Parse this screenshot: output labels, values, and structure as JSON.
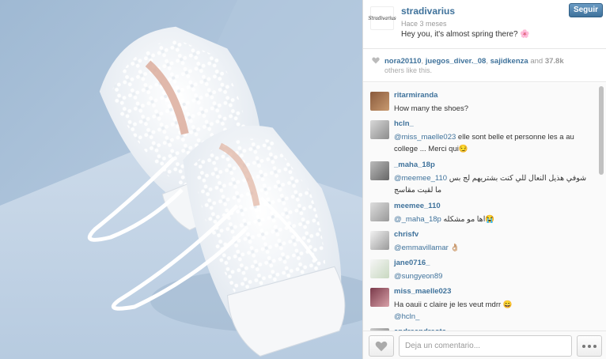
{
  "post": {
    "username": "stradivarius",
    "avatar_text": "Stradivarius",
    "time": "Hace 3 meses",
    "caption": "Hey you, it's almost spring there? 🌸",
    "follow_label": "Seguir"
  },
  "likes": {
    "user1": "nora20110",
    "user2": "juegos_diver._08",
    "user3": "sajidkenza",
    "separator": ",",
    "and": "and",
    "count": "37.8k",
    "others": "others like this."
  },
  "comments": [
    {
      "user": "ritarmiranda",
      "text": "How many the shoes?"
    },
    {
      "user": "hcln_",
      "mention": "@miss_maelle023",
      "text": " elle sont belle et personne les a au college ... Merci qui😏"
    },
    {
      "user": "_maha_18p",
      "mention": "@meemee_110",
      "text": " شوفي هذيل النعال للي كنت بشتريهم لج بس ما لقيت مقاسج"
    },
    {
      "user": "meemee_110",
      "text": "اها مو مشكله😭",
      "mention": "@_maha_18p"
    },
    {
      "user": "chrisfv",
      "mention": "@emmavillamar",
      "text": " 👌🏼"
    },
    {
      "user": "jane0716_",
      "mention": "@sungyeon89",
      "text": ""
    },
    {
      "user": "miss_maelle023",
      "text": "Ha oauii c claire                    je les veut mdrr 😄",
      "mention": "@hcln_"
    },
    {
      "user": "andreandreota",
      "text": ""
    }
  ],
  "footer": {
    "comment_placeholder": "Deja un comentario..."
  },
  "colors": {
    "link": "#3f729b",
    "follow_button": "#3f729b"
  },
  "icons": [
    "heart-icon",
    "more-dots-icon"
  ]
}
